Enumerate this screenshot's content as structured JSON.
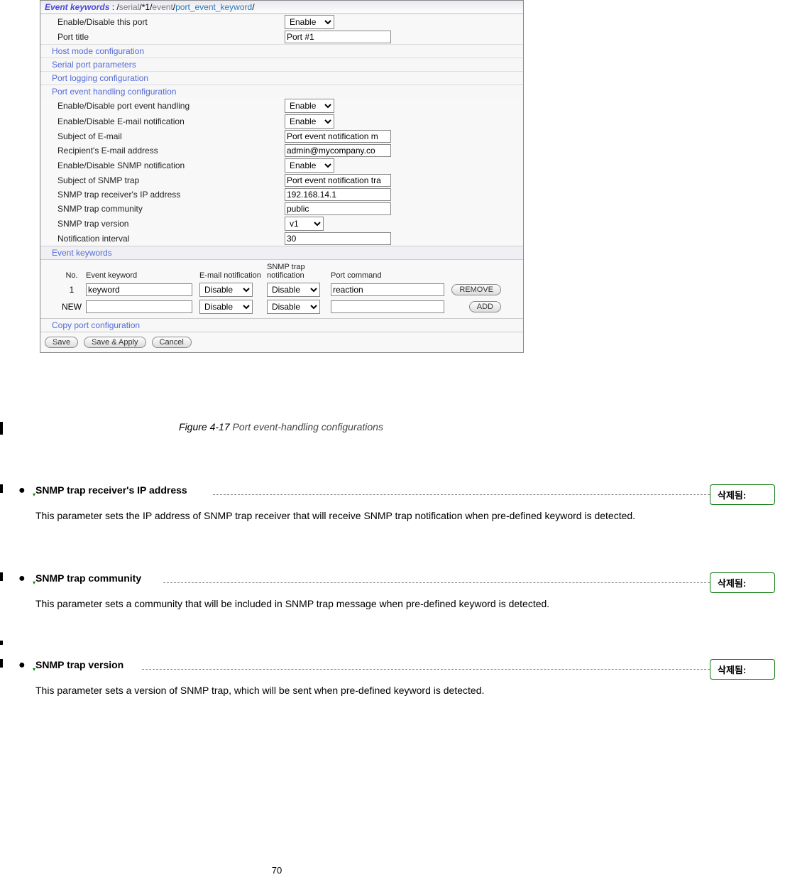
{
  "header": {
    "title": "Event keywords",
    "sep": " : /",
    "p1": "serial",
    "s1": "/*1/",
    "p2": "event",
    "s2": "/",
    "p3": "port_event_keyword",
    "s3": "/"
  },
  "top_rows": {
    "enable_port_label": "Enable/Disable this port",
    "enable_port_value": "Enable",
    "port_title_label": "Port title",
    "port_title_value": "Port #1"
  },
  "links": {
    "host_mode": "Host mode configuration",
    "serial_params": "Serial port parameters",
    "port_logging": "Port logging configuration",
    "port_event": "Port event handling configuration"
  },
  "events": {
    "eh_label": "Enable/Disable port event handling",
    "eh_value": "Enable",
    "email_en_label": "Enable/Disable E-mail notification",
    "email_en_value": "Enable",
    "subj_email_label": "Subject of E-mail",
    "subj_email_value": "Port event notification m",
    "recip_label": "Recipient's E-mail address",
    "recip_value": "admin@mycompany.co",
    "snmp_en_label": "Enable/Disable SNMP notification",
    "snmp_en_value": "Enable",
    "subj_snmp_label": "Subject of SNMP trap",
    "subj_snmp_value": "Port event notification tra",
    "snmp_ip_label": "SNMP trap receiver's IP address",
    "snmp_ip_value": "192.168.14.1",
    "snmp_comm_label": "SNMP trap community",
    "snmp_comm_value": "public",
    "snmp_ver_label": "SNMP trap version",
    "snmp_ver_value": "v1",
    "notif_int_label": "Notification interval",
    "notif_int_value": "30"
  },
  "kw_section": {
    "title": "Event keywords",
    "h_no": "No.",
    "h_kw": "Event keyword",
    "h_email": "E-mail notification",
    "h_snmp": "SNMP trap notification",
    "h_cmd": "Port command",
    "r1_no": "1",
    "r1_kw": "keyword",
    "r1_email": "Disable",
    "r1_snmp": "Disable",
    "r1_cmd": "reaction",
    "r1_btn": "REMOVE",
    "r2_no": "NEW",
    "r2_kw": "",
    "r2_email": "Disable",
    "r2_snmp": "Disable",
    "r2_cmd": "",
    "r2_btn": "ADD"
  },
  "copy_link": "Copy port configuration",
  "buttons": {
    "save": "Save",
    "save_apply": "Save & Apply",
    "cancel": "Cancel"
  },
  "caption": {
    "fig": "Figure 4-17 ",
    "figtitle": "Port event-handling configurations"
  },
  "doc": {
    "b1_title": "SNMP trap receiver's IP address",
    "b1_body": "This parameter sets the IP address of SNMP trap receiver that will receive SNMP trap notification when pre-defined keyword is detected.",
    "b2_title": "SNMP trap community",
    "b2_body": "This parameter sets a community that will be included in SNMP trap message when pre-defined keyword is detected.",
    "b3_title": "SNMP trap version",
    "b3_body": "This parameter sets a version of SNMP trap, which will be sent when pre-defined keyword is detected.",
    "bullet": "●",
    "rev_label": "삭제됨: ",
    "pagenum": "70"
  }
}
